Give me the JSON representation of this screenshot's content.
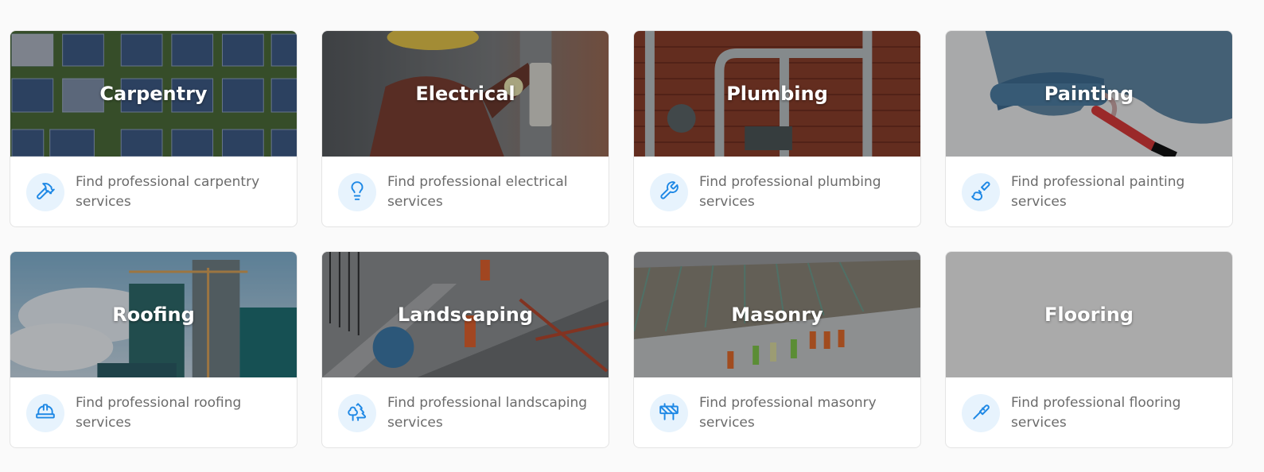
{
  "services": [
    {
      "title": "Carpentry",
      "description": "Find professional carpentry services",
      "icon": "hammer-icon",
      "accent": "#1e88e5"
    },
    {
      "title": "Electrical",
      "description": "Find professional electrical services",
      "icon": "lightbulb-icon",
      "accent": "#1e88e5"
    },
    {
      "title": "Plumbing",
      "description": "Find professional plumbing services",
      "icon": "wrench-icon",
      "accent": "#1e88e5"
    },
    {
      "title": "Painting",
      "description": "Find professional painting services",
      "icon": "paintbrush-icon",
      "accent": "#1e88e5"
    },
    {
      "title": "Roofing",
      "description": "Find professional roofing services",
      "icon": "hard-hat-icon",
      "accent": "#1e88e5"
    },
    {
      "title": "Landscaping",
      "description": "Find professional landscaping services",
      "icon": "trees-icon",
      "accent": "#1e88e5"
    },
    {
      "title": "Masonry",
      "description": "Find professional masonry services",
      "icon": "construction-barrier-icon",
      "accent": "#1e88e5"
    },
    {
      "title": "Flooring",
      "description": "Find professional flooring services",
      "icon": "paint-roller-icon",
      "accent": "#1e88e5"
    }
  ]
}
